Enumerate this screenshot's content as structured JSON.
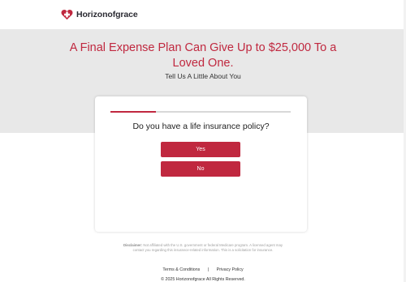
{
  "brand": {
    "name": "Horizonofgrace",
    "accent": "#c0283f",
    "logo_icon": "heart-cross-icon"
  },
  "hero": {
    "title": "A Final Expense Plan Can Give Up to $25,000 To a Loved One.",
    "subtitle": "Tell Us A Little About You"
  },
  "form": {
    "progress_fraction": 0.25,
    "question": "Do you have a life insurance policy?",
    "options": [
      "Yes",
      "No"
    ]
  },
  "footer": {
    "disclaimer_label": "Disclaimer:",
    "disclaimer_text": " Not affiliated with the U.S. government or federal Medicare program. A licensed agent may contact you regarding this insurance-related information. This is a solicitation for insurance.",
    "links": [
      "Terms & Conditions",
      "|",
      "Privacy Policy"
    ],
    "copyright": "© 2025 Horizonofgrace All Rights Reserved."
  }
}
